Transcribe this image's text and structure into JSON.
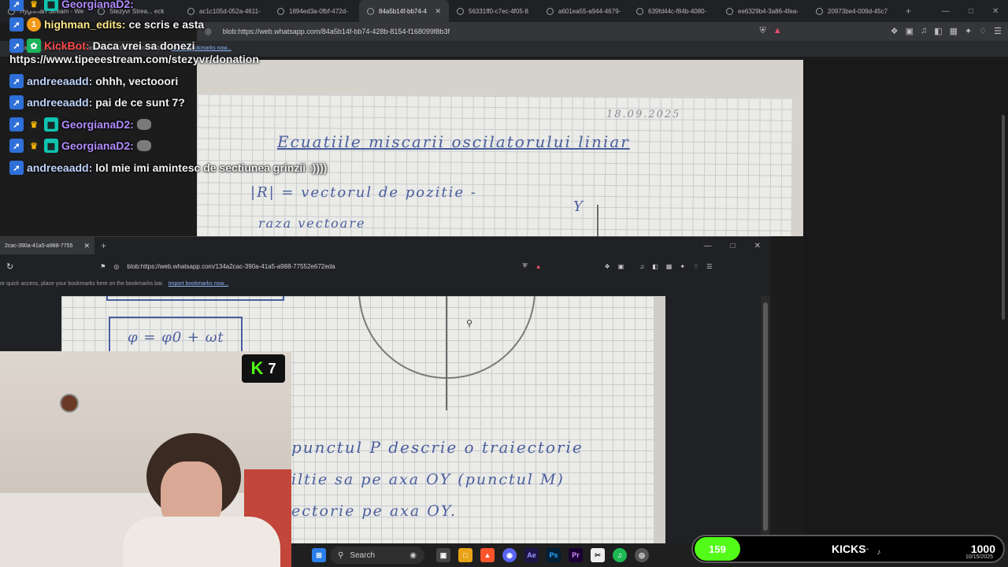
{
  "browser_top": {
    "tabs": [
      {
        "label": "Hyghman Stream - We"
      },
      {
        "label": "Stezyvr Strea... eck"
      },
      {
        "label": "ac1c105d-052a-4611-"
      },
      {
        "label": "1894ed3a-0fbf-472d-"
      },
      {
        "label": "84a5b14f-bb74-4",
        "active": true
      },
      {
        "label": "56331ff0-c7ec-4f05-8"
      },
      {
        "label": "a601ea55-a944-4679-"
      },
      {
        "label": "639fd44c-f84b-4080-"
      },
      {
        "label": "ee6329b4-3a86-4fea-"
      },
      {
        "label": "20973be4-009d-45c7"
      }
    ],
    "new_tab": "+",
    "url": "blob:https://web.whatsapp.com/84a5b14f-bb74-428b-8154-f168099f8b3f",
    "bookmarks_hint": "quick access, place your bookmarks here on the bookmarks bar.",
    "bookmarks_link": "Import bookmarks now..."
  },
  "notebook_top": {
    "date": "18.09.2025",
    "title": "Ecuatiile miscarii oscilatorului liniar",
    "line1": "|R| = vectorul de pozitie -",
    "line2": "raza vectoare",
    "axis": "Y"
  },
  "chat": [
    {
      "user": "GeorgianaD2:",
      "text": "",
      "color": "purple",
      "badges": [
        "blue",
        "crown",
        "sq"
      ]
    },
    {
      "user": "highman_edits:",
      "text": "ce scris e asta",
      "color": "yellow",
      "badges": [
        "blue",
        "orange"
      ],
      "badge_text": "1"
    },
    {
      "user": "KickBot:",
      "text": "Daca vrei sa donezi",
      "color": "red",
      "badges": [
        "blue",
        "green"
      ]
    },
    {
      "user": "andreeaadd:",
      "text": "ohhh, vectooori",
      "color": "blue",
      "badges": [
        "blue"
      ]
    },
    {
      "user": "andreeaadd:",
      "text": "pai de ce sunt 7?",
      "color": "blue",
      "badges": [
        "blue"
      ]
    },
    {
      "user": "GeorgianaD2:",
      "text": "",
      "color": "purple",
      "badges": [
        "blue",
        "crown",
        "sq"
      ],
      "emote": true
    },
    {
      "user": "GeorgianaD2:",
      "text": "",
      "color": "purple",
      "badges": [
        "blue",
        "crown",
        "sq"
      ],
      "emote": true
    },
    {
      "user": "andreeaadd:",
      "text": "lol mie imi amintesc de sectiunea grinzii :))))",
      "color": "blue",
      "badges": [
        "blue"
      ]
    }
  ],
  "chat_url": "https://www.tipeeestream.com/stezyvr/donation",
  "browser_bottom": {
    "tab": "2cac-390a-41a5-a988-7755",
    "url": "blob:https://web.whatsapp.com/134a2cac-390a-41a5-a988-77552e672eda",
    "bookmarks_hint": "or quick access, place your bookmarks here on the bookmarks bar.",
    "bookmarks_link": "Import bookmarks now..."
  },
  "notebook_bottom": {
    "formula": "φ = φ0 + ωt",
    "line1": "punctul P descrie o traiectorie",
    "line2": "iltie sa pe axa OY (punctul M)",
    "line3": "ectorie pe axa OY."
  },
  "kick_viewers": "7",
  "taskbar": {
    "search": "Search"
  },
  "kicks": {
    "count": "159",
    "label": "KICKS",
    "goal": "1000"
  },
  "clock": {
    "date": "10/15/2025"
  }
}
